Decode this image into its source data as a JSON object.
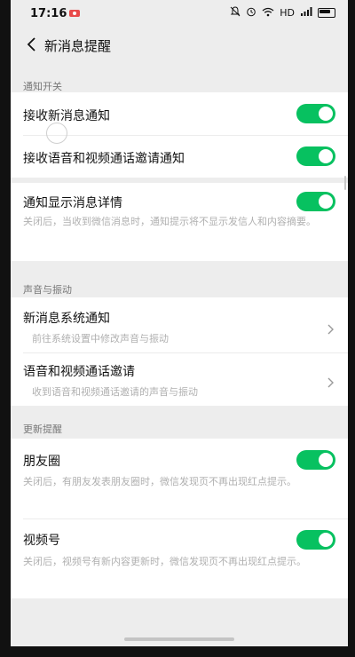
{
  "status": {
    "time": "17:16",
    "network": "HD",
    "signal": "4G"
  },
  "nav": {
    "title": "新消息提醒"
  },
  "sections": {
    "notify": "通知开关",
    "sound": "声音与振动",
    "update": "更新提醒"
  },
  "notify_toggles": {
    "new_msg": {
      "label": "接收新消息通知",
      "on": true
    },
    "av_call": {
      "label": "接收语音和视频通话邀请通知",
      "on": true
    }
  },
  "detail": {
    "label": "通知显示消息详情",
    "on": true,
    "desc": "关闭后，当收到微信消息时，通知提示将不显示发信人和内容摘要。"
  },
  "sound_items": {
    "system": {
      "label": "新消息系统通知",
      "desc": "前往系统设置中修改声音与振动"
    },
    "call": {
      "label": "语音和视频通话邀请",
      "desc": "收到语音和视频通话邀请的声音与振动"
    }
  },
  "moments": {
    "label": "朋友圈",
    "on": true,
    "desc": "关闭后，有朋友发表朋友圈时，微信发现页不再出现红点提示。"
  },
  "channels": {
    "label": "视频号",
    "on": true,
    "desc": "关闭后，视频号有新内容更新时，微信发现页不再出现红点提示。"
  },
  "colors": {
    "toggle_on": "#07c160",
    "bg": "#ededed",
    "card": "#ffffff"
  }
}
